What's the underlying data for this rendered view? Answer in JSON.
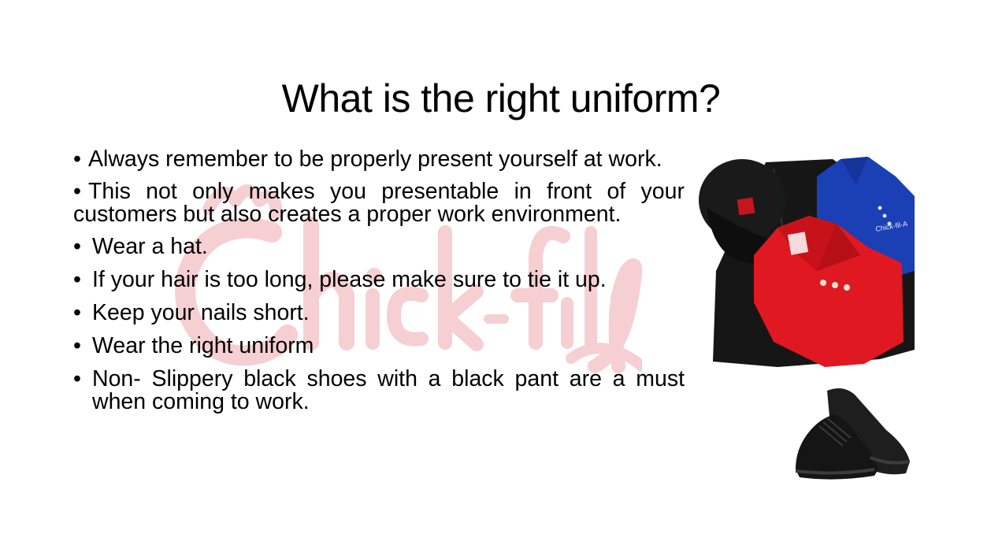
{
  "slide": {
    "title": "What is the right uniform?",
    "bullets": [
      "Always remember to be properly present yourself at work.",
      "This not only makes you presentable in front of your customers but also  creates a proper work environment.",
      "Wear a hat.",
      "If your hair is too long, please make sure to tie it up.",
      "Keep your nails short.",
      "Wear the right uniform",
      "Non- Slippery black shoes with a black pant are a must when coming to work."
    ],
    "bullet_symbol": "•"
  },
  "watermark": {
    "logo_text": "Chick-fil-A",
    "registered_mark": "®",
    "color": "#f6cfd3"
  },
  "images": {
    "uniform_photo": {
      "icon": "uniform-photo",
      "colors": {
        "cap": "#141414",
        "blue_shirt": "#1b3fb5",
        "red_shirt": "#e01822",
        "pants": "#151515"
      }
    },
    "shoes_photo": {
      "icon": "black-shoes-photo",
      "colors": {
        "shoe": "#1a1a1a"
      }
    }
  }
}
